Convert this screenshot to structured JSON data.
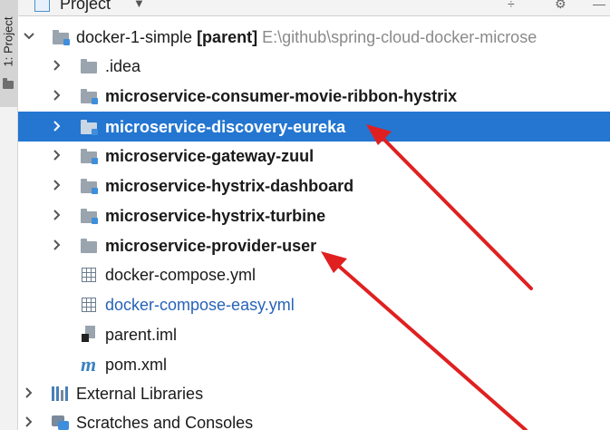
{
  "sidebar": {
    "tab_label": "1: Project"
  },
  "header": {
    "title": "Project",
    "caret": "▼",
    "buttons": [
      "÷",
      "⚙",
      "—"
    ]
  },
  "tree": {
    "root": {
      "name": "docker-1-simple",
      "tag": "[parent]",
      "path": "E:\\github\\spring-cloud-docker-microse"
    },
    "children": [
      {
        "label": "docker-1-simple",
        "icon": "module-folder-icon"
      },
      {
        "label": ".idea",
        "icon": "folder-icon"
      },
      {
        "label": "microservice-consumer-movie-ribbon-hystrix",
        "icon": "module-folder-icon"
      },
      {
        "label": "microservice-discovery-eureka",
        "icon": "module-folder-icon",
        "selected": true
      },
      {
        "label": "microservice-gateway-zuul",
        "icon": "module-folder-icon"
      },
      {
        "label": "microservice-hystrix-dashboard",
        "icon": "module-folder-icon"
      },
      {
        "label": "microservice-hystrix-turbine",
        "icon": "module-folder-icon"
      },
      {
        "label": "microservice-provider-user",
        "icon": "module-folder-icon"
      },
      {
        "label": "docker-compose.yml",
        "icon": "yml-file-icon"
      },
      {
        "label": "docker-compose-easy.yml",
        "icon": "yml-file-icon"
      },
      {
        "label": "parent.iml",
        "icon": "iml-file-icon"
      },
      {
        "label": "pom.xml",
        "icon": "maven-icon"
      },
      {
        "label": "External Libraries",
        "icon": "libraries-icon"
      },
      {
        "label": "Scratches and Consoles",
        "icon": "scratches-icon"
      }
    ]
  },
  "colors": {
    "selection": "#2476d0",
    "annotation_arrow": "#e02020",
    "modified_file": "#2763b8"
  }
}
